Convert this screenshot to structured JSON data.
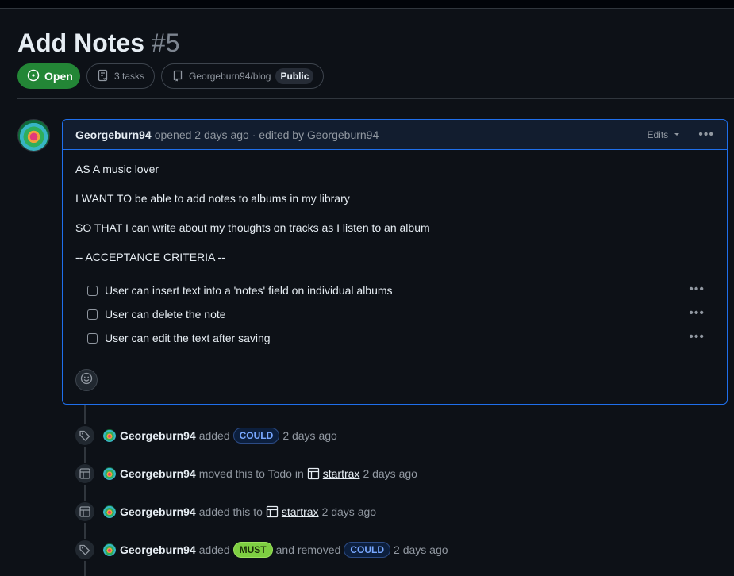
{
  "issue": {
    "title": "Add Notes",
    "number": "#5",
    "state": "Open",
    "tasks": "3 tasks",
    "repo": "Georgeburn94/blog",
    "visibility": "Public"
  },
  "comment": {
    "author": "Georgeburn94",
    "meta": "opened 2 days ago · edited by Georgeburn94",
    "edits_label": "Edits",
    "paragraphs": [
      "AS A music lover",
      "I WANT TO be able to add notes to albums in my library",
      "SO THAT I can write about my thoughts on tracks as I listen to an album",
      "-- ACCEPTANCE CRITERIA --"
    ],
    "tasks": [
      {
        "text": "User can insert text into a 'notes' field on individual albums",
        "checked": false
      },
      {
        "text": "User can delete the note",
        "checked": false
      },
      {
        "text": "User can edit the text after saving",
        "checked": false
      }
    ]
  },
  "timeline": [
    {
      "icon": "tag-icon",
      "actor": "Georgeburn94",
      "text1": "added",
      "label1": "COULD",
      "time": "2 days ago"
    },
    {
      "icon": "table-icon",
      "actor": "Georgeburn94",
      "text1": "moved this to Todo in",
      "project": "startrax",
      "time": "2 days ago"
    },
    {
      "icon": "table-icon",
      "actor": "Georgeburn94",
      "text1": "added this to",
      "project": "startrax",
      "time": "2 days ago"
    },
    {
      "icon": "tag-icon",
      "actor": "Georgeburn94",
      "text1": "added",
      "label1": "MUST",
      "text2": "and removed",
      "label2": "COULD",
      "time": "2 days ago"
    }
  ],
  "colors": {
    "background": "#0d1117",
    "open_green": "#238636",
    "accent_blue": "#1f6feb",
    "must_label": "#7ecf42",
    "could_label": "#79a8ff"
  }
}
